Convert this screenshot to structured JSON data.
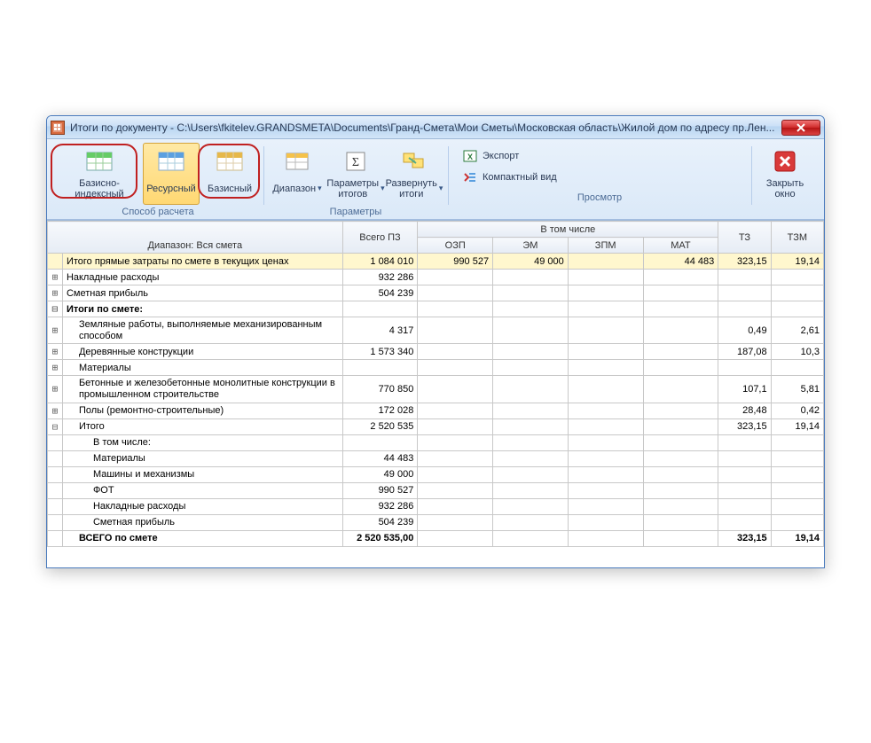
{
  "window": {
    "title": "Итоги по документу - C:\\Users\\fkitelev.GRANDSMETA\\Documents\\Гранд-Смета\\Мои Сметы\\Московская область\\Жилой дом по адресу пр.Лен..."
  },
  "ribbon": {
    "calc_group_label": "Способ расчета",
    "params_group_label": "Параметры",
    "view_group_label": "Просмотр",
    "btn_basis_index": "Базисно-индексный",
    "btn_resource": "Ресурсный",
    "btn_basis": "Базисный",
    "btn_range": "Диапазон",
    "btn_params": "Параметры итогов",
    "btn_expand": "Развернуть итоги",
    "btn_export": "Экспорт",
    "btn_compact": "Компактный вид",
    "btn_close": "Закрыть окно"
  },
  "headers": {
    "range_label": "Диапазон: Вся смета",
    "vsego_pz": "Всего ПЗ",
    "vtomchisle": "В том числе",
    "ozp": "ОЗП",
    "em": "ЭМ",
    "zpm": "ЗПМ",
    "mat": "МАТ",
    "tz": "ТЗ",
    "tzm": "ТЗМ"
  },
  "rows": [
    {
      "exp": "",
      "name": "Итого прямые затраты по смете в текущих ценах",
      "pz": "1 084 010",
      "ozp": "990 527",
      "em": "49 000",
      "zpm": "",
      "mat": "44 483",
      "tz": "323,15",
      "tzm": "19,14",
      "hl": true,
      "indent": 0
    },
    {
      "exp": "⊞",
      "name": "Накладные расходы",
      "pz": "932 286",
      "ozp": "",
      "em": "",
      "zpm": "",
      "mat": "",
      "tz": "",
      "tzm": "",
      "indent": 0
    },
    {
      "exp": "⊞",
      "name": "Сметная прибыль",
      "pz": "504 239",
      "ozp": "",
      "em": "",
      "zpm": "",
      "mat": "",
      "tz": "",
      "tzm": "",
      "indent": 0
    },
    {
      "exp": "⊟",
      "name": "Итоги по смете:",
      "pz": "",
      "ozp": "",
      "em": "",
      "zpm": "",
      "mat": "",
      "tz": "",
      "tzm": "",
      "bold": true,
      "indent": 0
    },
    {
      "exp": "⊞",
      "name": "Земляные работы, выполняемые механизированным способом",
      "pz": "4 317",
      "ozp": "",
      "em": "",
      "zpm": "",
      "mat": "",
      "tz": "0,49",
      "tzm": "2,61",
      "indent": 1,
      "wrap": true
    },
    {
      "exp": "⊞",
      "name": "Деревянные конструкции",
      "pz": "1 573 340",
      "ozp": "",
      "em": "",
      "zpm": "",
      "mat": "",
      "tz": "187,08",
      "tzm": "10,3",
      "indent": 1
    },
    {
      "exp": "⊞",
      "name": "Материалы",
      "pz": "",
      "ozp": "",
      "em": "",
      "zpm": "",
      "mat": "",
      "tz": "",
      "tzm": "",
      "indent": 1
    },
    {
      "exp": "⊞",
      "name": "Бетонные и железобетонные монолитные конструкции в промышленном строительстве",
      "pz": "770 850",
      "ozp": "",
      "em": "",
      "zpm": "",
      "mat": "",
      "tz": "107,1",
      "tzm": "5,81",
      "indent": 1,
      "wrap": true
    },
    {
      "exp": "⊞",
      "name": "Полы (ремонтно-строительные)",
      "pz": "172 028",
      "ozp": "",
      "em": "",
      "zpm": "",
      "mat": "",
      "tz": "28,48",
      "tzm": "0,42",
      "indent": 1
    },
    {
      "exp": "⊟",
      "name": "Итого",
      "pz": "2 520 535",
      "ozp": "",
      "em": "",
      "zpm": "",
      "mat": "",
      "tz": "323,15",
      "tzm": "19,14",
      "indent": 1
    },
    {
      "exp": "",
      "name": "В том числе:",
      "pz": "",
      "ozp": "",
      "em": "",
      "zpm": "",
      "mat": "",
      "tz": "",
      "tzm": "",
      "indent": 2
    },
    {
      "exp": "",
      "name": "Материалы",
      "pz": "44 483",
      "ozp": "",
      "em": "",
      "zpm": "",
      "mat": "",
      "tz": "",
      "tzm": "",
      "indent": 2
    },
    {
      "exp": "",
      "name": "Машины и механизмы",
      "pz": "49 000",
      "ozp": "",
      "em": "",
      "zpm": "",
      "mat": "",
      "tz": "",
      "tzm": "",
      "indent": 2
    },
    {
      "exp": "",
      "name": "ФОТ",
      "pz": "990 527",
      "ozp": "",
      "em": "",
      "zpm": "",
      "mat": "",
      "tz": "",
      "tzm": "",
      "indent": 2
    },
    {
      "exp": "",
      "name": "Накладные расходы",
      "pz": "932 286",
      "ozp": "",
      "em": "",
      "zpm": "",
      "mat": "",
      "tz": "",
      "tzm": "",
      "indent": 2
    },
    {
      "exp": "",
      "name": "Сметная прибыль",
      "pz": "504 239",
      "ozp": "",
      "em": "",
      "zpm": "",
      "mat": "",
      "tz": "",
      "tzm": "",
      "indent": 2
    },
    {
      "exp": "",
      "name": "ВСЕГО по смете",
      "pz": "2 520 535,00",
      "ozp": "",
      "em": "",
      "zpm": "",
      "mat": "",
      "tz": "323,15",
      "tzm": "19,14",
      "bold": true,
      "indent": 1
    }
  ]
}
